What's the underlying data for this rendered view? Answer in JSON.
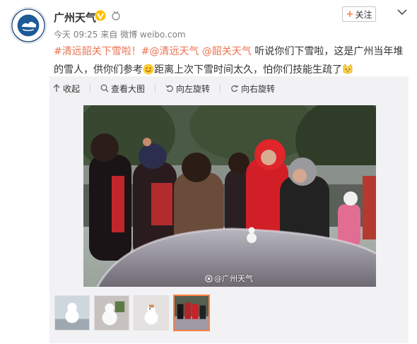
{
  "post": {
    "author": "广州天气",
    "time": "今天 09:25",
    "source_prefix": "来自",
    "source": "微博 weibo.com",
    "text_parts": [
      {
        "t": "#清远韶关下雪啦！#",
        "link": true
      },
      {
        "t": "@清远天气",
        "link": true
      },
      {
        "t": " ",
        "link": false
      },
      {
        "t": "@韶关天气",
        "link": true
      },
      {
        "t": " 听说你们下雪啦，这是广州当年堆的雪人，供你们参考",
        "link": false
      },
      {
        "t": "距离上次下雪时间太久，怕你们技能生疏了",
        "link": false
      }
    ],
    "follow_label": "关注"
  },
  "media_toolbar": {
    "collapse": "收起",
    "view_large": "查看大图",
    "rotate_left": "向左旋转",
    "rotate_right": "向右旋转"
  },
  "watermark": "@广州天气",
  "thumbnails": [
    {
      "label": "snowman-1",
      "active": false
    },
    {
      "label": "snowman-2",
      "active": false
    },
    {
      "label": "snowman-3",
      "active": false
    },
    {
      "label": "crowd-photo",
      "active": true
    }
  ],
  "colors": {
    "accent": "#ff8140",
    "link": "#eb7350",
    "verified": "#ffc000"
  },
  "icons": [
    "avatar-logo-icon",
    "verified-v-icon",
    "medal-icon",
    "chevron-down-icon",
    "collapse-icon",
    "zoom-icon",
    "rotate-left-icon",
    "rotate-right-icon",
    "smile-emoji-icon",
    "cat-emoji-icon",
    "weibo-eye-icon"
  ]
}
